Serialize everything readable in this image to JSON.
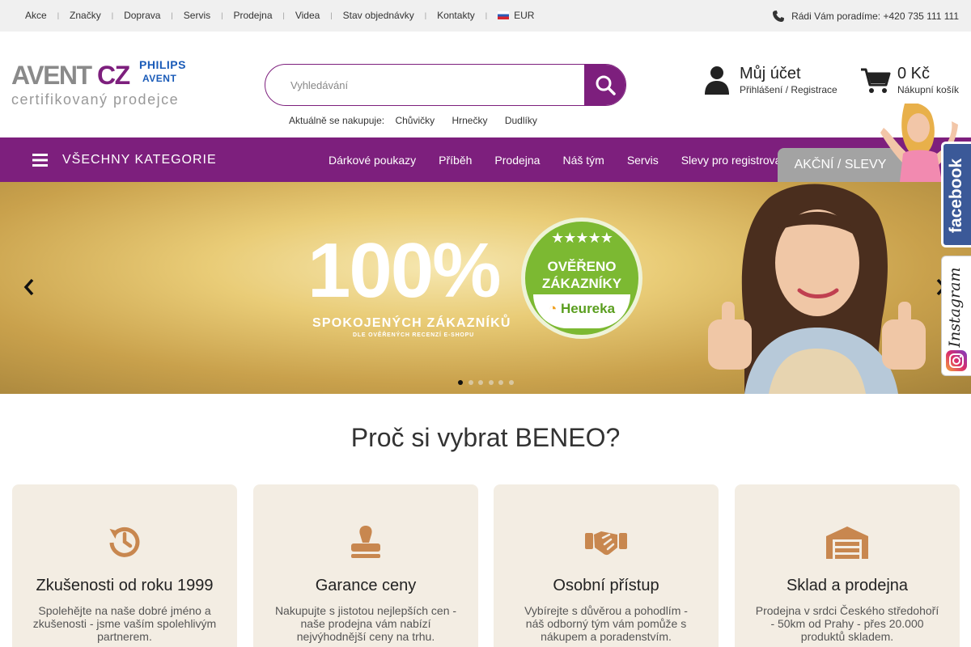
{
  "topbar": {
    "nav": [
      "Akce",
      "Značky",
      "Doprava",
      "Servis",
      "Prodejna",
      "Videa",
      "Stav objednávky",
      "Kontakty"
    ],
    "currency": "EUR",
    "phone_text": "Rádi Vám poradíme: +420 735 111 111"
  },
  "header": {
    "logo": {
      "name_left": "AVENT",
      "name_right": "CZ",
      "brand1": "PHILIPS",
      "brand2": "AVENT",
      "tagline": "certifikovaný prodejce"
    },
    "search": {
      "placeholder": "Vyhledávání",
      "value": ""
    },
    "trending_label": "Aktuálně se nakupuje:",
    "trending": [
      "Chůvičky",
      "Hrnečky",
      "Dudlíky"
    ],
    "account": {
      "title": "Můj účet",
      "subtitle": "Přihlášení / Registrace"
    },
    "cart": {
      "total": "0 Kč",
      "label": "Nákupní košík"
    }
  },
  "catbar": {
    "all_categories": "VŠECHNY KATEGORIE",
    "links": [
      "Dárkové poukazy",
      "Příběh",
      "Prodejna",
      "Náš tým",
      "Servis",
      "Slevy pro registrované"
    ],
    "sale_tab": "AKČNÍ / SLEVY"
  },
  "hero": {
    "headline": "100%",
    "subline": "SPOKOJENÝCH ZÁKAZNÍKŮ",
    "subline2": "DLE OVĚŘENÝCH RECENZÍ E-SHOPU",
    "badge_line1": "OVĚŘENO",
    "badge_line2": "ZÁKAZNÍKY",
    "badge_brand": "Heureka",
    "slide_count": 6,
    "active_slide": 1
  },
  "social": {
    "facebook": "facebook",
    "instagram": "Instagram"
  },
  "why": {
    "title": "Proč si vybrat BENEO?",
    "cards": [
      {
        "icon": "history-icon",
        "title": "Zkušenosti od roku 1999",
        "text": "Spolehějte na naše dobré jméno a zkušenosti - jsme vaším spolehlivým partnerem."
      },
      {
        "icon": "stamp-icon",
        "title": "Garance ceny",
        "text": "Nakupujte s jistotou nejlepších cen - naše prodejna vám nabízí nejvýhodnější ceny na trhu."
      },
      {
        "icon": "handshake-icon",
        "title": "Osobní přístup",
        "text": "Vybírejte s důvěrou a pohodlím - náš odborný tým vám pomůže s nákupem a poradenstvím."
      },
      {
        "icon": "warehouse-icon",
        "title": "Sklad a prodejna",
        "text": "Prodejna v srdci Českého středohoří - 50km od Prahy - přes 20.000 produktů skladem."
      }
    ]
  },
  "colors": {
    "brand": "#7d1f7d",
    "card_bg": "#f3ede3",
    "icon": "#c8874f",
    "topbar": "#f0f0f0"
  }
}
